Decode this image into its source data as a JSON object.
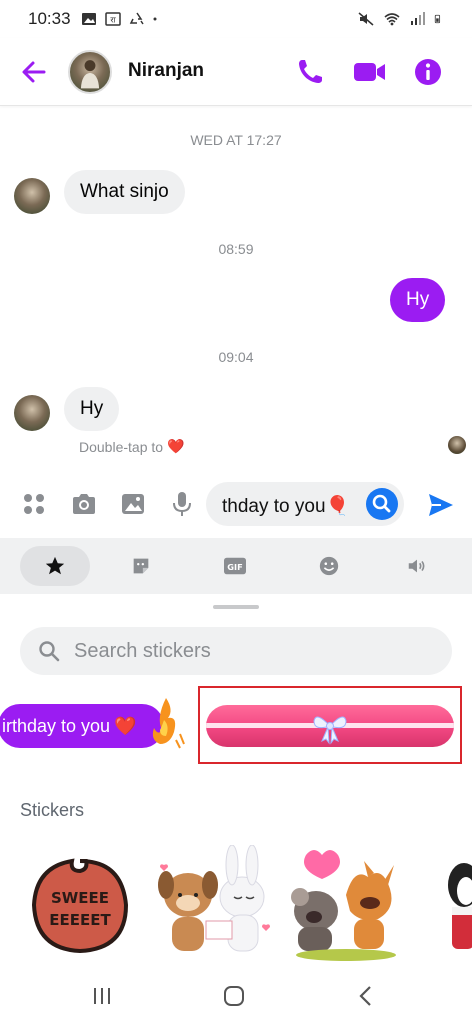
{
  "status_bar": {
    "time": "10:33",
    "icons_left": [
      "image-icon",
      "dictionary-icon",
      "recycle-icon",
      "dot-icon"
    ],
    "icons_right": [
      "mute-icon",
      "wifi-icon",
      "signal-icon",
      "battery-icon"
    ]
  },
  "header": {
    "contact_name": "Niranjan",
    "actions": [
      "phone-icon",
      "video-icon",
      "info-icon"
    ],
    "accent_color": "#9b1cf2"
  },
  "chat": {
    "messages": [
      {
        "type": "timestamp",
        "text": "WED AT 17:27"
      },
      {
        "type": "incoming",
        "text": "What sinjo"
      },
      {
        "type": "timestamp",
        "text": "08:59"
      },
      {
        "type": "outgoing",
        "text": "Hy"
      },
      {
        "type": "timestamp",
        "text": "09:04"
      },
      {
        "type": "incoming",
        "text": "Hy"
      }
    ],
    "hint_text": "Double-tap to",
    "hint_emoji": "❤️"
  },
  "composer": {
    "input_value": "thday to you🎈",
    "icons": [
      "apps-icon",
      "camera-icon",
      "gallery-icon",
      "microphone-icon",
      "search-icon",
      "send-icon"
    ]
  },
  "sticker_tabs": [
    {
      "icon": "star-icon",
      "active": true
    },
    {
      "icon": "sticker-icon",
      "active": false
    },
    {
      "icon": "gif-icon",
      "label": "GIF",
      "active": false
    },
    {
      "icon": "emoji-icon",
      "active": false
    },
    {
      "icon": "sound-icon",
      "active": false
    }
  ],
  "sticker_search": {
    "placeholder": "Search stickers"
  },
  "suggestions": {
    "birthday_text": "irthday to you",
    "birthday_emoji": "❤️"
  },
  "stickers_section": {
    "label": "Stickers",
    "cookie_text": "SWEEE EEEEET"
  }
}
